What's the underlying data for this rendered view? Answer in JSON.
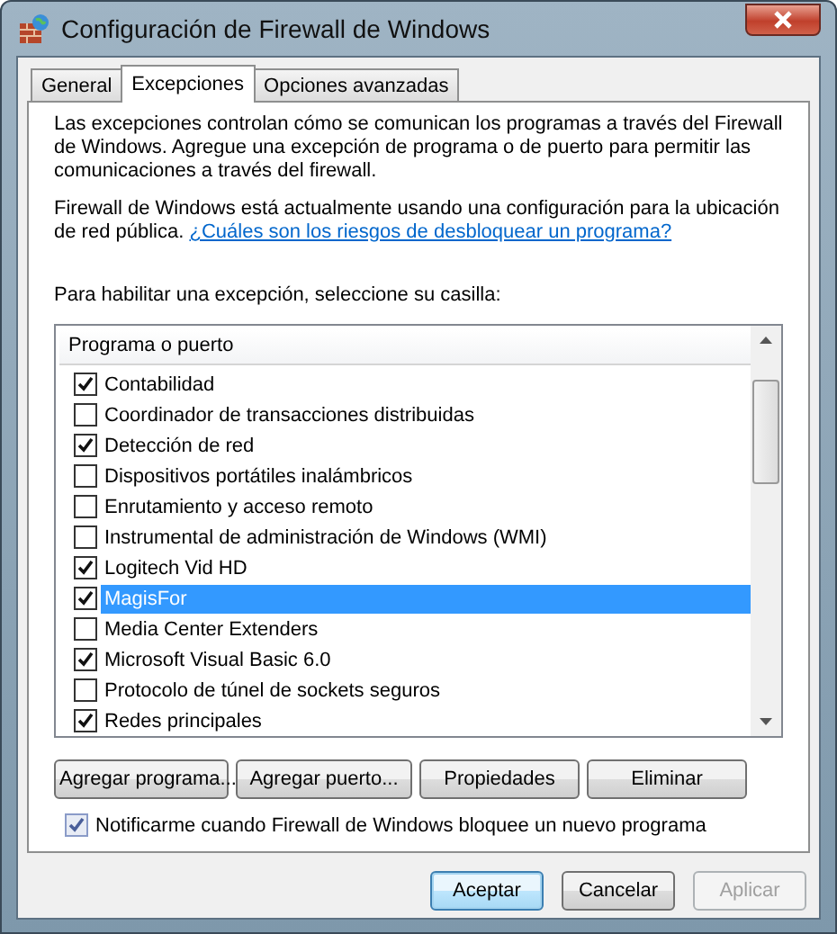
{
  "window": {
    "title": "Configuración de Firewall de Windows"
  },
  "tabs": [
    {
      "label": "General",
      "selected": false
    },
    {
      "label": "Excepciones",
      "selected": true
    },
    {
      "label": "Opciones avanzadas",
      "selected": false
    }
  ],
  "intro": "Las excepciones controlan cómo se comunican los programas a través del Firewall de Windows. Agregue una excepción de programa o de puerto para permitir las comunicaciones a través del firewall.",
  "location_note": "Firewall de Windows está actualmente usando una configuración para la ubicación de red pública.",
  "risk_link": "¿Cuáles son los riesgos de desbloquear un programa?",
  "list_prompt": "Para habilitar una excepción, seleccione su casilla:",
  "exceptions": {
    "column": "Programa o puerto",
    "items": [
      {
        "label": "Contabilidad",
        "checked": true,
        "selected": false
      },
      {
        "label": "Coordinador de transacciones distribuidas",
        "checked": false,
        "selected": false
      },
      {
        "label": "Detección de red",
        "checked": true,
        "selected": false
      },
      {
        "label": "Dispositivos portátiles inalámbricos",
        "checked": false,
        "selected": false
      },
      {
        "label": "Enrutamiento y acceso remoto",
        "checked": false,
        "selected": false
      },
      {
        "label": "Instrumental de administración de Windows (WMI)",
        "checked": false,
        "selected": false
      },
      {
        "label": "Logitech Vid HD",
        "checked": true,
        "selected": false
      },
      {
        "label": "MagisFor",
        "checked": true,
        "selected": true
      },
      {
        "label": "Media Center Extenders",
        "checked": false,
        "selected": false
      },
      {
        "label": "Microsoft Visual Basic 6.0",
        "checked": true,
        "selected": false
      },
      {
        "label": "Protocolo de túnel de sockets seguros",
        "checked": false,
        "selected": false
      },
      {
        "label": "Redes principales",
        "checked": true,
        "selected": false
      }
    ]
  },
  "list_buttons": [
    "Agregar programa...",
    "Agregar puerto...",
    "Propiedades",
    "Eliminar"
  ],
  "notify": {
    "label": "Notificarme cuando Firewall de Windows bloquee un nuevo programa",
    "checked": true
  },
  "dialog_buttons": [
    {
      "label": "Aceptar",
      "disabled": false,
      "default": true
    },
    {
      "label": "Cancelar",
      "disabled": false,
      "default": false
    },
    {
      "label": "Aplicar",
      "disabled": true,
      "default": false
    }
  ]
}
